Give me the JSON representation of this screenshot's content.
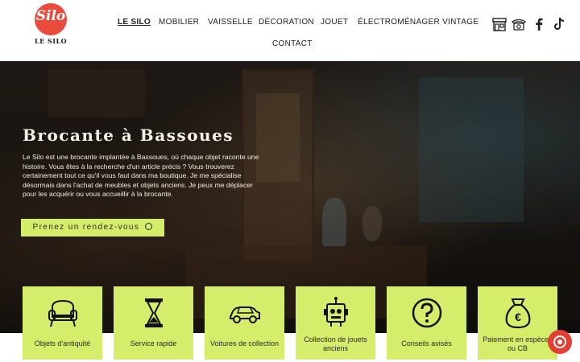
{
  "brand": {
    "logo_mark": "Silo",
    "name": "LE SILO",
    "accent": "#e94b3c",
    "green": "#d4ee6b"
  },
  "nav": {
    "items": [
      "LE SILO",
      "MOBILIER",
      "VAISSELLE",
      "DÉCORATION",
      "JOUET",
      "ÉLECTROMÉNAGER VINTAGE",
      "CONTACT"
    ],
    "active": "LE SILO"
  },
  "social": [
    "shop-icon",
    "phone-icon",
    "facebook-icon",
    "tiktok-icon"
  ],
  "hero": {
    "title": "Brocante à Bassoues",
    "text": "Le Silo est une brocante implantée à Bassoues, où chaque objet raconte une histoire. Vous êtes à la recherche d'un article précis ? Vous trouverez certainement tout ce qu'il vous faut dans ma boutique. Je me spécialise désormais dans l'achat de meubles et objets anciens. Je peux me déplacer pour les acquérir ou vous accueillir à la brocante.",
    "cta": "Prenez un rendez-vous"
  },
  "features": [
    {
      "label": "Objets d'antiquité",
      "icon": "armchair-icon"
    },
    {
      "label": "Service rapide",
      "icon": "hourglass-icon"
    },
    {
      "label": "Voitures de collection",
      "icon": "car-icon"
    },
    {
      "label": "Collection de jouets anciens",
      "icon": "robot-toy-icon"
    },
    {
      "label": "Conseils avisés",
      "icon": "question-icon"
    },
    {
      "label": "Paiement en espèces ou CB",
      "icon": "money-bag-icon"
    }
  ]
}
